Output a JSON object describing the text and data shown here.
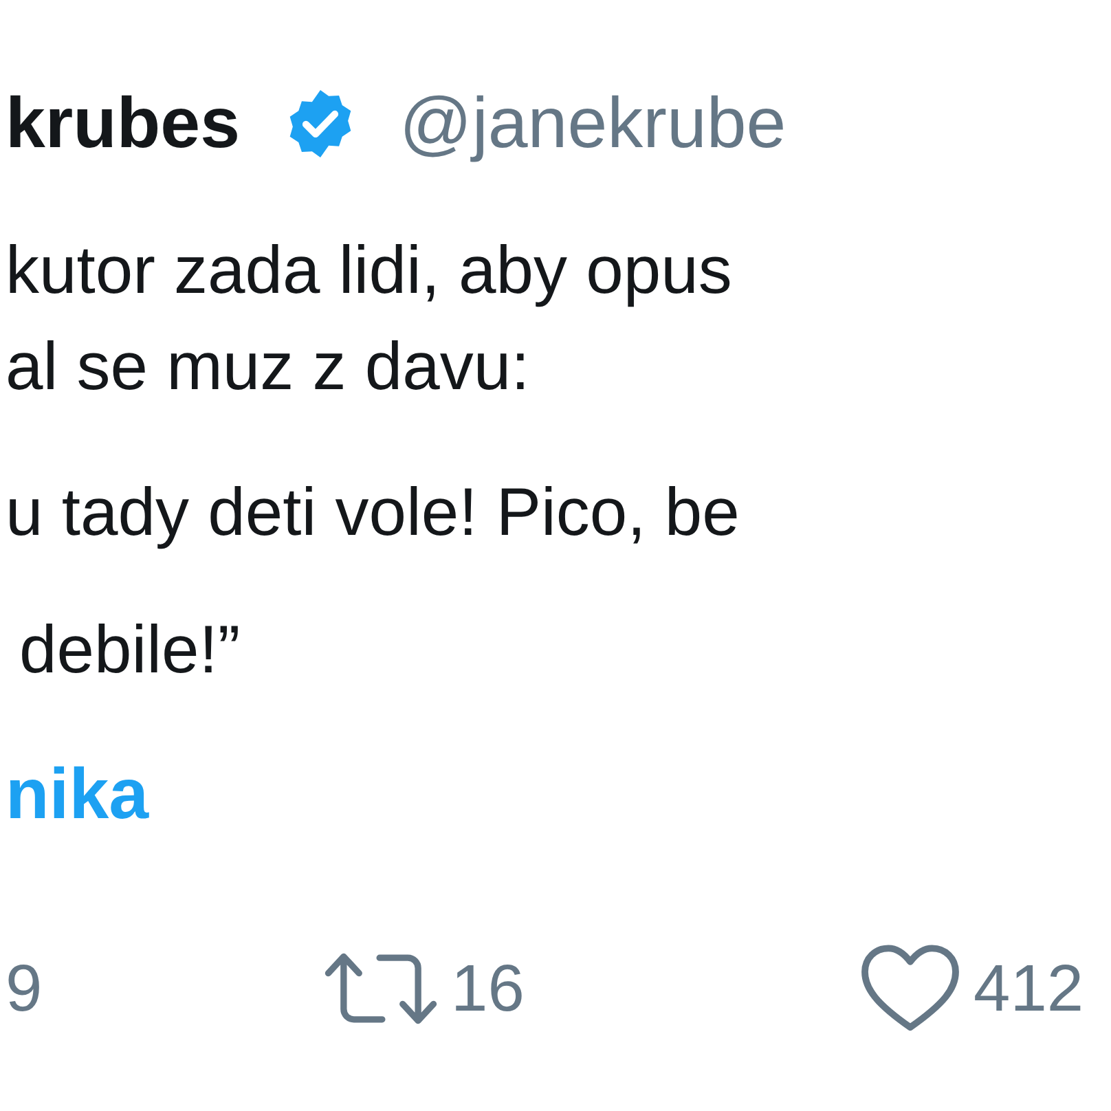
{
  "author": {
    "name": "krubes",
    "verified": true,
    "handle": "@janekrube"
  },
  "tweet_lines": [
    "kutor zada lidi, aby opus",
    "al se muz z davu:",
    "u tady deti vole! Pico, be",
    "debile!”"
  ],
  "hashtag": "nika",
  "actions": [
    {
      "kind": "reply",
      "count": "9"
    },
    {
      "kind": "retweet",
      "count": "16"
    },
    {
      "kind": "like",
      "count": "412"
    }
  ]
}
